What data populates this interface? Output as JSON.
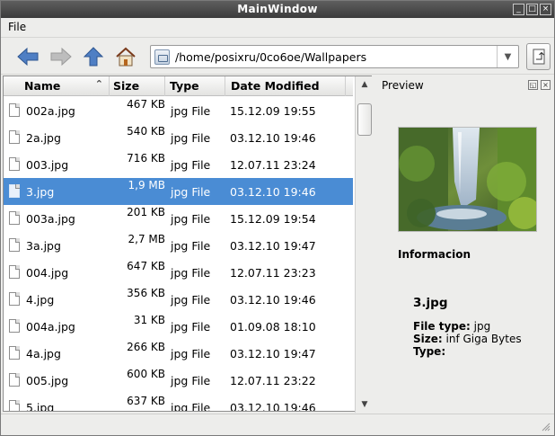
{
  "window": {
    "title": "MainWindow"
  },
  "menu": {
    "file": "File"
  },
  "toolbar": {
    "path": "/home/posixru/0co6oe/Wallpapers"
  },
  "table": {
    "headers": {
      "name": "Name",
      "size": "Size",
      "type": "Type",
      "date": "Date Modified"
    },
    "rows": [
      {
        "name": "002a.jpg",
        "size": "467 KB",
        "type": "jpg File",
        "date": "15.12.09 19:55",
        "selected": false
      },
      {
        "name": "2a.jpg",
        "size": "540 KB",
        "type": "jpg File",
        "date": "03.12.10 19:46",
        "selected": false
      },
      {
        "name": "003.jpg",
        "size": "716 KB",
        "type": "jpg File",
        "date": "12.07.11 23:24",
        "selected": false
      },
      {
        "name": "3.jpg",
        "size": "1,9 MB",
        "type": "jpg File",
        "date": "03.12.10 19:46",
        "selected": true
      },
      {
        "name": "003a.jpg",
        "size": "201 KB",
        "type": "jpg File",
        "date": "15.12.09 19:54",
        "selected": false
      },
      {
        "name": "3a.jpg",
        "size": "2,7 MB",
        "type": "jpg File",
        "date": "03.12.10 19:47",
        "selected": false
      },
      {
        "name": "004.jpg",
        "size": "647 KB",
        "type": "jpg File",
        "date": "12.07.11 23:23",
        "selected": false
      },
      {
        "name": "4.jpg",
        "size": "356 KB",
        "type": "jpg File",
        "date": "03.12.10 19:46",
        "selected": false
      },
      {
        "name": "004a.jpg",
        "size": "31 KB",
        "type": "jpg File",
        "date": "01.09.08 18:10",
        "selected": false
      },
      {
        "name": "4a.jpg",
        "size": "266 KB",
        "type": "jpg File",
        "date": "03.12.10 19:47",
        "selected": false
      },
      {
        "name": "005.jpg",
        "size": "600 KB",
        "type": "jpg File",
        "date": "12.07.11 23:22",
        "selected": false
      },
      {
        "name": "5.jpg",
        "size": "637 KB",
        "type": "jpg File",
        "date": "03.12.10 19:46",
        "selected": false
      }
    ]
  },
  "preview": {
    "title": "Preview",
    "info_heading": "Informacion",
    "file_name": "3.jpg",
    "file_type_label": "File type:",
    "file_type_value": "jpg",
    "size_label": "Size:",
    "size_value": "inf Giga Bytes",
    "type_label": "Type:"
  },
  "colors": {
    "selection": "#4a8cd4",
    "arrow": "#4f7fc4"
  }
}
